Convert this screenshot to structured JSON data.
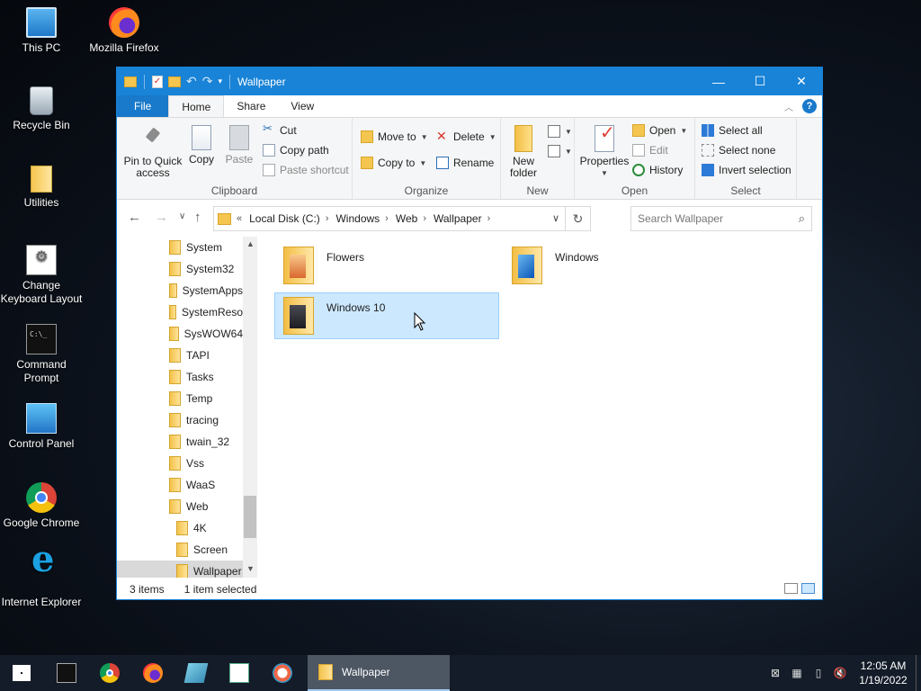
{
  "desktop": {
    "icons": [
      {
        "label": "This PC"
      },
      {
        "label": "Mozilla Firefox"
      },
      {
        "label": "Recycle Bin"
      },
      {
        "label": "Utilities"
      },
      {
        "label": "Change Keyboard Layout"
      },
      {
        "label": "Command Prompt"
      },
      {
        "label": "Control Panel"
      },
      {
        "label": "Google Chrome"
      },
      {
        "label": "Internet Explorer"
      }
    ]
  },
  "window": {
    "title": "Wallpaper",
    "controls": {
      "minimize": "—",
      "maximize": "☐",
      "close": "✕"
    },
    "tabs": [
      "File",
      "Home",
      "Share",
      "View"
    ],
    "help": "?",
    "ribbon": {
      "clipboard": {
        "label": "Clipboard",
        "pin": "Pin to Quick access",
        "pin_line1": "Pin to Quick",
        "pin_line2": "access",
        "copy": "Copy",
        "paste": "Paste",
        "cut": "Cut",
        "copy_path": "Copy path",
        "paste_shortcut": "Paste shortcut"
      },
      "organize": {
        "label": "Organize",
        "move_to": "Move to",
        "copy_to": "Copy to",
        "delete": "Delete",
        "rename": "Rename"
      },
      "new": {
        "label": "New",
        "new_folder_line1": "New",
        "new_folder_line2": "folder"
      },
      "open": {
        "label": "Open",
        "properties": "Properties",
        "open": "Open",
        "edit": "Edit",
        "history": "History"
      },
      "select": {
        "label": "Select",
        "select_all": "Select all",
        "select_none": "Select none",
        "invert": "Invert selection"
      }
    },
    "address": {
      "overflow": "«",
      "crumbs": [
        "Local Disk (C:)",
        "Windows",
        "Web",
        "Wallpaper"
      ],
      "search_placeholder": "Search Wallpaper"
    },
    "tree": [
      "System",
      "System32",
      "SystemApps",
      "SystemReso",
      "SysWOW64",
      "TAPI",
      "Tasks",
      "Temp",
      "tracing",
      "twain_32",
      "Vss",
      "WaaS",
      "Web",
      "4K",
      "Screen",
      "Wallpaper"
    ],
    "files": [
      {
        "name": "Flowers"
      },
      {
        "name": "Windows"
      },
      {
        "name": "Windows 10"
      }
    ],
    "status": {
      "items": "3 items",
      "selected": "1 item selected"
    }
  },
  "taskbar": {
    "active_window": "Wallpaper",
    "time": "12:05 AM",
    "date": "1/19/2022"
  }
}
